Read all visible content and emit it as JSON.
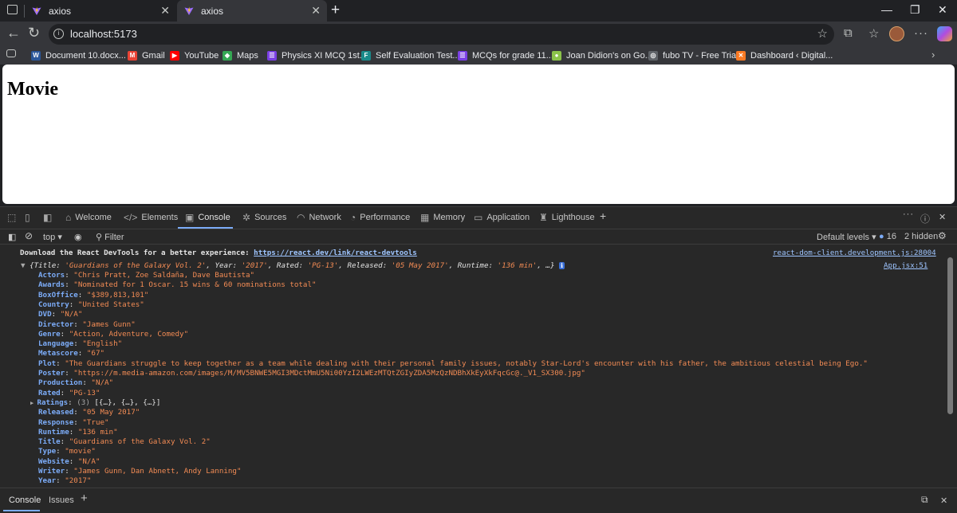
{
  "browser": {
    "tabs": [
      {
        "title": "axios",
        "active": false
      },
      {
        "title": "axios",
        "active": true
      }
    ],
    "url": "localhost:5173",
    "bookmarks": [
      {
        "label": "Document 10.docx...",
        "icon": "word-icon",
        "color": "#2b579a",
        "glyph": "W"
      },
      {
        "label": "Gmail",
        "icon": "gmail-icon",
        "color": "#ea4335",
        "glyph": "M"
      },
      {
        "label": "YouTube",
        "icon": "youtube-icon",
        "color": "#ff0000",
        "glyph": "▶"
      },
      {
        "label": "Maps",
        "icon": "maps-icon",
        "color": "#34a853",
        "glyph": "◆"
      },
      {
        "label": "Physics XI MCQ 1st...",
        "icon": "list-icon",
        "color": "#7b3fe4",
        "glyph": "☰"
      },
      {
        "label": "Self Evaluation Test...",
        "icon": "forms-icon",
        "color": "#1a8a8a",
        "glyph": "F"
      },
      {
        "label": "MCQs for grade 11...",
        "icon": "list-icon",
        "color": "#7b3fe4",
        "glyph": "☰"
      },
      {
        "label": "Joan Didion's on Go...",
        "icon": "android-icon",
        "color": "#8bc34a",
        "glyph": "●"
      },
      {
        "label": "fubo TV - Free Trial",
        "icon": "globe-icon",
        "color": "#5f6368",
        "glyph": "◎"
      },
      {
        "label": "Dashboard ‹ Digital...",
        "icon": "xampp-icon",
        "color": "#fb7a24",
        "glyph": "✕"
      }
    ]
  },
  "page": {
    "heading": "Movie"
  },
  "devtools": {
    "tabs": [
      "Welcome",
      "Elements",
      "Console",
      "Sources",
      "Network",
      "Performance",
      "Memory",
      "Application",
      "Lighthouse"
    ],
    "active_tab": "Console",
    "context": "top",
    "filter_placeholder": "Filter",
    "levels": "Default levels",
    "issues_count": "16",
    "hidden_count": "2 hidden",
    "drawer_tabs": [
      "Console",
      "Issues"
    ],
    "devtools_message": {
      "text": "Download the React DevTools for a better experience: ",
      "link": "https://react.dev/link/react-devtools",
      "source": "react-dom-client.development.js:28004"
    },
    "log_source": "App.jsx:51",
    "summary": {
      "open": "{",
      "parts": [
        {
          "k": "Title",
          "v": "'Guardians of the Galaxy Vol. 2'"
        },
        {
          "k": "Year",
          "v": "'2017'"
        },
        {
          "k": "Rated",
          "v": "'PG-13'"
        },
        {
          "k": "Released",
          "v": "'05 May 2017'"
        },
        {
          "k": "Runtime",
          "v": "'136 min'"
        }
      ],
      "close": ", …}"
    },
    "properties": [
      {
        "k": "Actors",
        "v": "\"Chris Pratt, Zoe Saldaña, Dave Bautista\""
      },
      {
        "k": "Awards",
        "v": "\"Nominated for 1 Oscar. 15 wins & 60 nominations total\""
      },
      {
        "k": "BoxOffice",
        "v": "\"$389,813,101\""
      },
      {
        "k": "Country",
        "v": "\"United States\""
      },
      {
        "k": "DVD",
        "v": "\"N/A\""
      },
      {
        "k": "Director",
        "v": "\"James Gunn\""
      },
      {
        "k": "Genre",
        "v": "\"Action, Adventure, Comedy\""
      },
      {
        "k": "Language",
        "v": "\"English\""
      },
      {
        "k": "Metascore",
        "v": "\"67\""
      },
      {
        "k": "Plot",
        "v": "\"The Guardians struggle to keep together as a team while dealing with their personal family issues, notably Star-Lord's encounter with his father, the ambitious celestial being Ego.\""
      },
      {
        "k": "Poster",
        "v": "\"https://m.media-amazon.com/images/M/MV5BNWE5MGI3MDctMmU5Ni00YzI2LWEzMTQtZGIyZDA5MzQzNDBhXkEyXkFqcGc@._V1_SX300.jpg\""
      },
      {
        "k": "Production",
        "v": "\"N/A\""
      },
      {
        "k": "Rated",
        "v": "\"PG-13\""
      },
      {
        "k": "Ratings",
        "v": "(3) [{…}, {…}, {…}]",
        "expandable": true
      },
      {
        "k": "Released",
        "v": "\"05 May 2017\""
      },
      {
        "k": "Response",
        "v": "\"True\""
      },
      {
        "k": "Runtime",
        "v": "\"136 min\""
      },
      {
        "k": "Title",
        "v": "\"Guardians of the Galaxy Vol. 2\""
      },
      {
        "k": "Type",
        "v": "\"movie\""
      },
      {
        "k": "Website",
        "v": "\"N/A\""
      },
      {
        "k": "Writer",
        "v": "\"James Gunn, Dan Abnett, Andy Lanning\""
      },
      {
        "k": "Year",
        "v": "\"2017\""
      }
    ]
  }
}
